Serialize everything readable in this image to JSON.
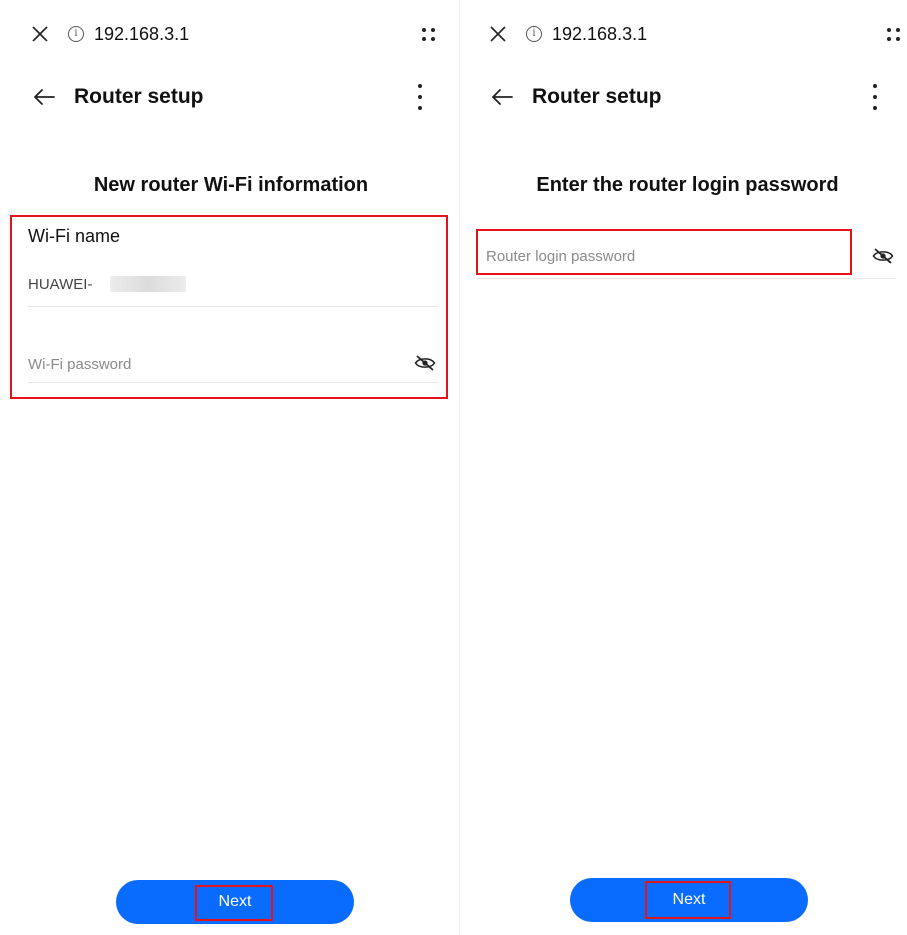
{
  "left": {
    "url": "192.168.3.1",
    "appbar_title": "Router setup",
    "section_title": "New router Wi-Fi information",
    "wifi_name_label": "Wi-Fi name",
    "wifi_name_value": "HUAWEI-",
    "wifi_password_placeholder": "Wi-Fi password",
    "next_label": "Next"
  },
  "right": {
    "url": "192.168.3.1",
    "appbar_title": "Router setup",
    "section_title": "Enter the router login password",
    "login_password_placeholder": "Router login password",
    "next_label": "Next"
  },
  "colors": {
    "accent_blue": "#0a6cff",
    "highlight_red": "#e4131b"
  }
}
